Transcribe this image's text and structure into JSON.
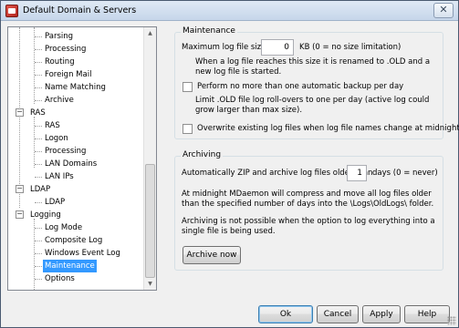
{
  "window": {
    "title": "Default Domain & Servers",
    "close_glyph": "✕"
  },
  "tree": {
    "items": [
      {
        "label": "Parsing",
        "level": 1
      },
      {
        "label": "Processing",
        "level": 1
      },
      {
        "label": "Routing",
        "level": 1
      },
      {
        "label": "Foreign Mail",
        "level": 1
      },
      {
        "label": "Name Matching",
        "level": 1
      },
      {
        "label": "Archive",
        "level": 1
      },
      {
        "label": "RAS",
        "level": 0
      },
      {
        "label": "RAS",
        "level": 1
      },
      {
        "label": "Logon",
        "level": 1
      },
      {
        "label": "Processing",
        "level": 1
      },
      {
        "label": "LAN Domains",
        "level": 1
      },
      {
        "label": "LAN IPs",
        "level": 1
      },
      {
        "label": "LDAP",
        "level": 0
      },
      {
        "label": "LDAP",
        "level": 1
      },
      {
        "label": "Logging",
        "level": 0
      },
      {
        "label": "Log Mode",
        "level": 1
      },
      {
        "label": "Composite Log",
        "level": 1
      },
      {
        "label": "Windows Event Log",
        "level": 1
      },
      {
        "label": "Maintenance",
        "level": 1,
        "selected": true
      },
      {
        "label": "Options",
        "level": 1
      }
    ],
    "expander_glyph": "−"
  },
  "maintenance": {
    "title": "Maintenance",
    "max_size_label": "Maximum log file size",
    "max_size_value": "0",
    "max_size_suffix": "KB (0 = no size limitation)",
    "max_size_note": "When a log file reaches this size it is renamed to .OLD and a new log file is started.",
    "backup_label": "Perform no more than one automatic backup per day",
    "backup_checked": false,
    "backup_note": "Limit .OLD file log roll-overs to one per day (active log could grow larger than max size).",
    "overwrite_label": "Overwrite existing log files when log file names change at midnight",
    "overwrite_checked": false
  },
  "archiving": {
    "title": "Archiving",
    "zip_label": "Automatically ZIP and archive log files older than",
    "zip_value": "1",
    "zip_suffix": "days (0 = never)",
    "note1": "At midnight MDaemon will compress and move all log files older than the specified number of days into the \\Logs\\OldLogs\\ folder.",
    "note2": "Archiving is not possible when the option to log everything into a single file is being used.",
    "archive_now_label": "Archive now"
  },
  "buttons": {
    "ok": "Ok",
    "cancel": "Cancel",
    "apply": "Apply",
    "help": "Help"
  }
}
